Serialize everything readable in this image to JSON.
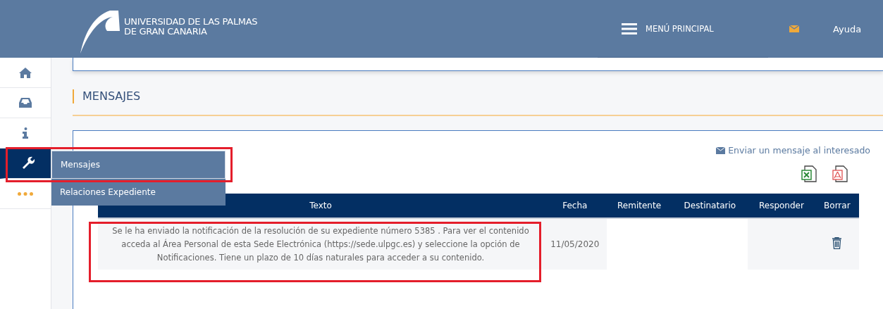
{
  "header": {
    "logo_lines": [
      "UNIVERSIDAD DE LAS PALMAS",
      "DE GRAN CANARIA"
    ],
    "menu_label": "MENÚ PRINCIPAL",
    "help_label": "Ayuda"
  },
  "sidebar": {
    "items": [
      {
        "kind": "home",
        "selected": false
      },
      {
        "kind": "inbox",
        "selected": false
      },
      {
        "kind": "info",
        "selected": false
      },
      {
        "kind": "wrench",
        "selected": true
      },
      {
        "kind": "more",
        "selected": false
      }
    ]
  },
  "flyout": {
    "items": [
      {
        "label": "Mensajes",
        "selected": true
      },
      {
        "label": "Relaciones Expediente",
        "selected": false
      }
    ]
  },
  "page_title": "MENSAJES",
  "send_link": "Enviar un mensaje al interesado",
  "table": {
    "columns": [
      "Texto",
      "Fecha",
      "Remitente",
      "Destinatario",
      "Responder",
      "Borrar"
    ],
    "rows": [
      {
        "texto": "Se le ha enviado la notificación de la resolución de su expediente número 5385 . Para ver el contenido acceda al Área Personal de esta Sede Electrónica (https://sede.ulpgc.es) y seleccione la opción de Notificaciones. Tiene un plazo de 10 días naturales para acceder a su contenido.",
        "fecha": "11/05/2020"
      }
    ]
  }
}
